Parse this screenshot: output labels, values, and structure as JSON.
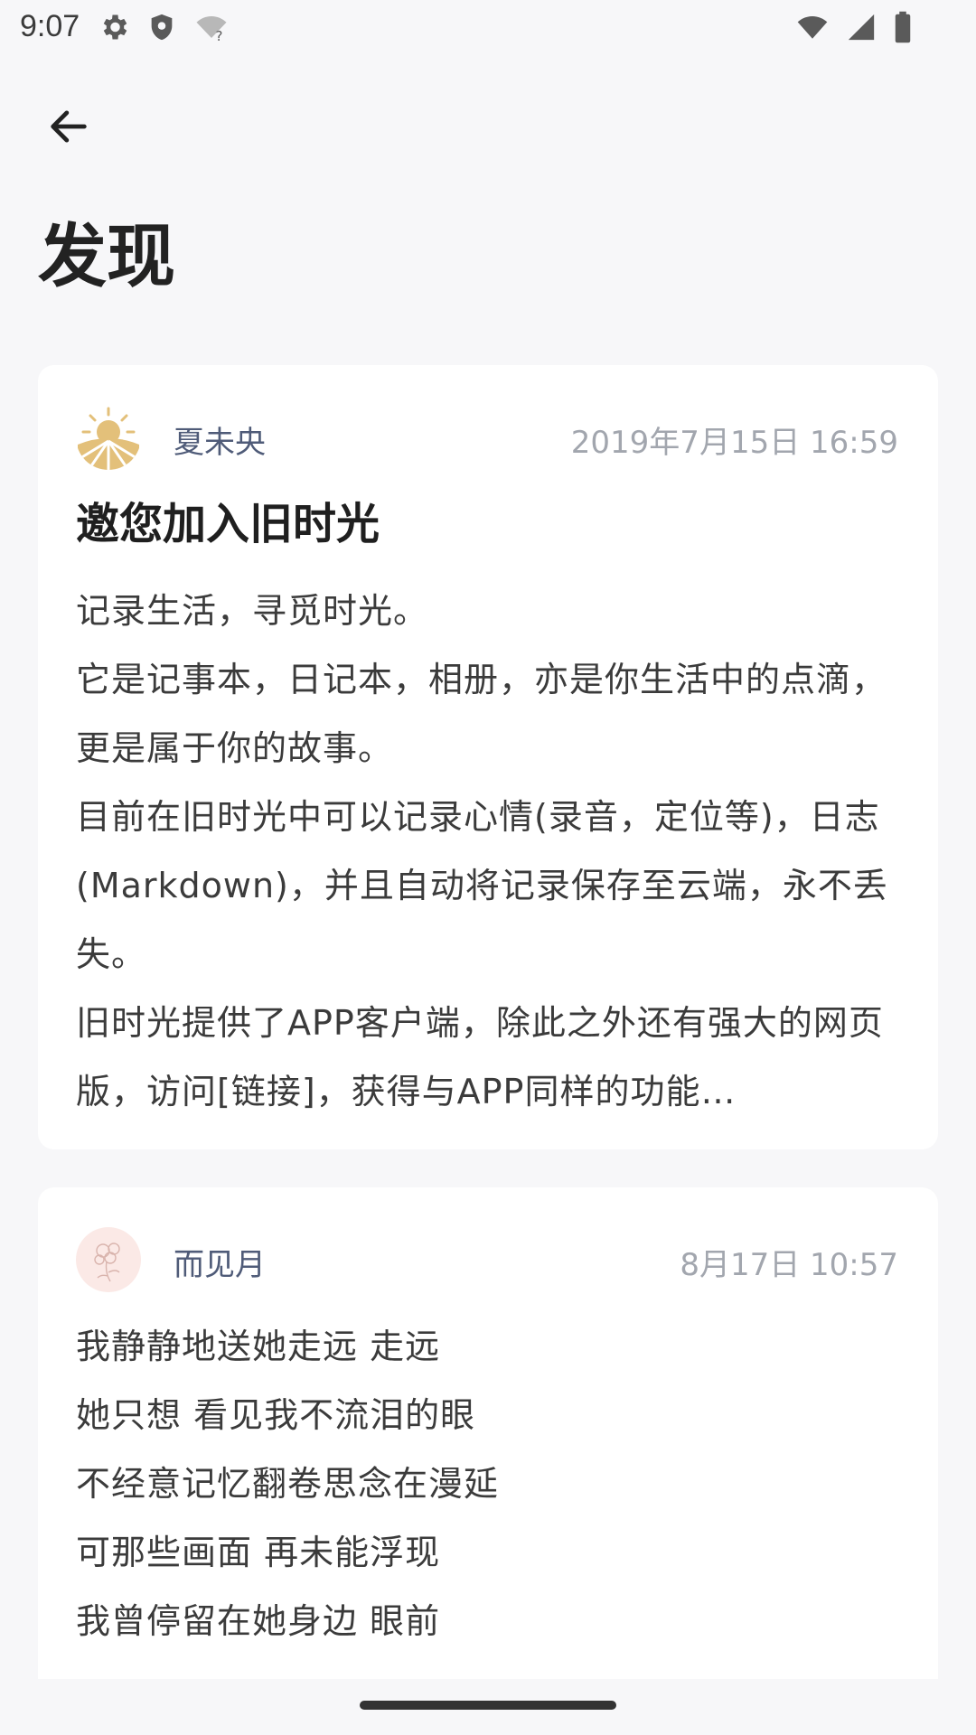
{
  "status_bar": {
    "time": "9:07",
    "icons_left": [
      "gear-icon",
      "shield-icon",
      "wifi-question-icon"
    ],
    "icons_right": [
      "wifi-icon",
      "signal-icon",
      "battery-icon"
    ]
  },
  "header": {
    "back_icon": "arrow-left-icon",
    "title": "发现"
  },
  "posts": [
    {
      "author": "夏未央",
      "time": "2019年7月15日 16:59",
      "title": "邀您加入旧时光",
      "body": [
        "记录生活，寻觅时光。",
        "它是记事本，日记本，相册，亦是你生活中的点滴，更是属于你的故事。",
        "目前在旧时光中可以记录心情(录音，定位等)，日志(Markdown)，并且自动将记录保存至云端，永不丢失。",
        "旧时光提供了APP客户端，除此之外还有强大的网页版，访问[链接]，获得与APP同样的功能…"
      ],
      "avatar_icon": "sun-logo-icon",
      "avatar_color": "#e3c07a"
    },
    {
      "author": "而见月",
      "time": "8月17日 10:57",
      "body": [
        "我静静地送她走远 走远",
        "她只想 看见我不流泪的眼",
        "不经意记忆翻卷思念在漫延",
        "可那些画面 再未能浮现",
        "我曾停留在她身边 眼前"
      ],
      "avatar_icon": "flower-sketch-icon",
      "avatar_color": "#fbe9e6"
    }
  ],
  "colors": {
    "background": "#f7f7f9",
    "card": "#ffffff",
    "author": "#4f5b78",
    "timestamp": "#a2a6ae"
  }
}
